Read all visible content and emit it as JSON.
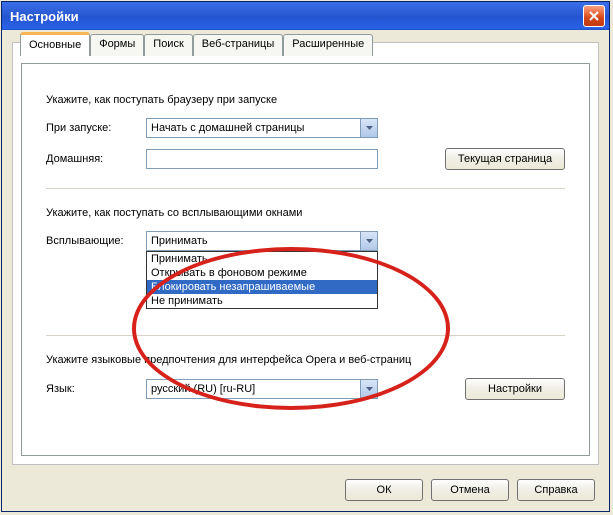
{
  "titlebar": {
    "title": "Настройки",
    "close_icon": "close"
  },
  "tabs": [
    {
      "label": "Основные",
      "active": true
    },
    {
      "label": "Формы",
      "active": false
    },
    {
      "label": "Поиск",
      "active": false
    },
    {
      "label": "Веб-страницы",
      "active": false
    },
    {
      "label": "Расширенные",
      "active": false
    }
  ],
  "section_startup": {
    "heading": "Укажите, как поступать браузеру при запуске",
    "row_startup_label": "При запуске:",
    "row_startup_value": "Начать с домашней страницы",
    "row_home_label": "Домашняя:",
    "row_home_value": "",
    "btn_current_page": "Текущая страница"
  },
  "section_popups": {
    "heading": "Укажите, как поступать со всплывающими окнами",
    "row_popups_label": "Всплывающие:",
    "row_popups_value": "Принимать",
    "options": [
      {
        "label": "Принимать",
        "highlighted": false
      },
      {
        "label": "Открывать в фоновом режиме",
        "highlighted": false
      },
      {
        "label": "Блокировать незапрашиваемые",
        "highlighted": true
      },
      {
        "label": "Не принимать",
        "highlighted": false
      }
    ]
  },
  "section_language": {
    "heading": "Укажите языковые предпочтения для интерфейса Opera и веб-страниц",
    "row_lang_label": "Язык:",
    "row_lang_value": "русский (RU) [ru-RU]",
    "btn_settings": "Настройки"
  },
  "dialog_buttons": {
    "ok": "ОК",
    "cancel": "Отмена",
    "help": "Справка"
  }
}
